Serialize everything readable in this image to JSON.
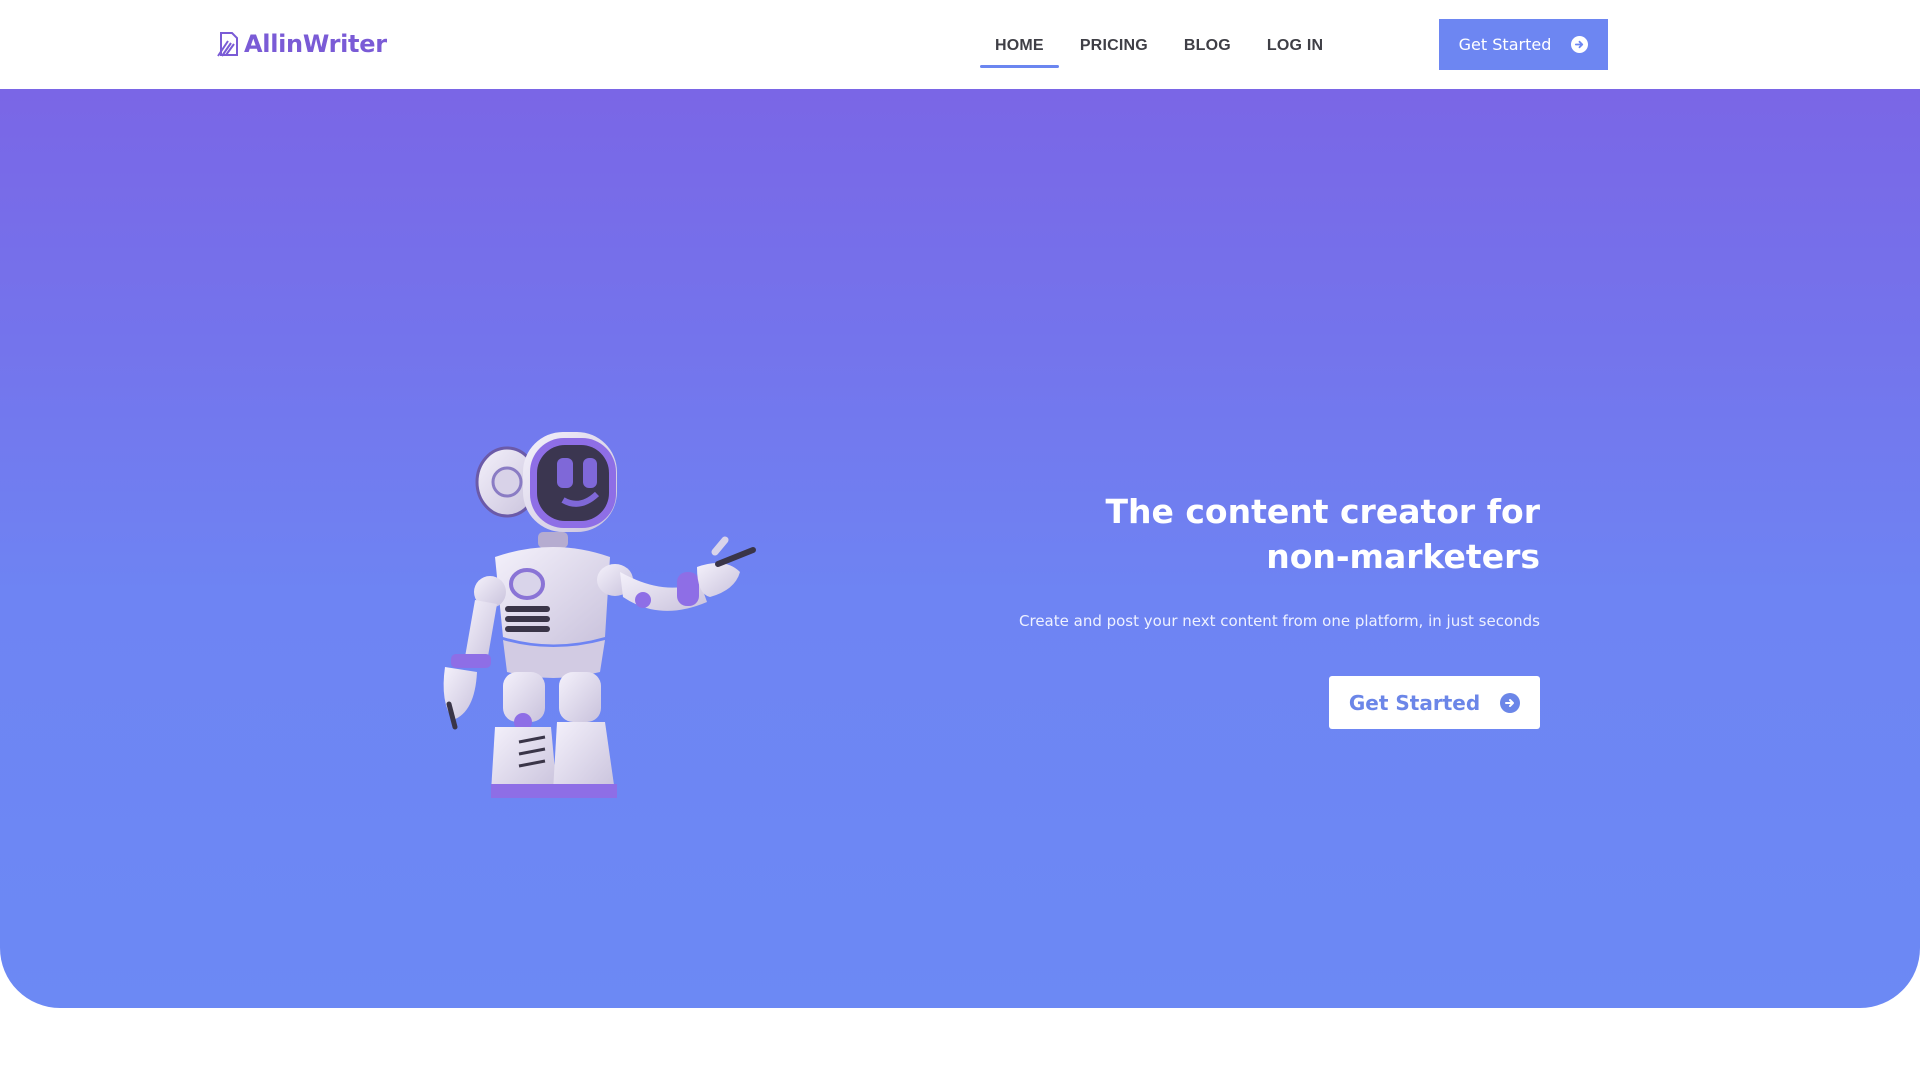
{
  "header": {
    "logo_text": "AllinWriter",
    "nav": [
      {
        "label": "HOME",
        "active": true
      },
      {
        "label": "PRICING",
        "active": false
      },
      {
        "label": "BLOG",
        "active": false
      },
      {
        "label": "LOG IN",
        "active": false
      }
    ],
    "cta_label": "Get Started"
  },
  "hero": {
    "title_line1": "The content creator for",
    "title_line2": "non-marketers",
    "subtitle": "Create and post your next content from one platform, in just seconds",
    "cta_label": "Get Started"
  },
  "colors": {
    "brand": "#7a5bd6",
    "accent": "#6d86f2",
    "hero_top": "#7a66e6",
    "hero_bottom": "#6c89f4"
  },
  "icons": [
    "logo-icon",
    "arrow-circle-right-icon",
    "robot-illustration"
  ]
}
